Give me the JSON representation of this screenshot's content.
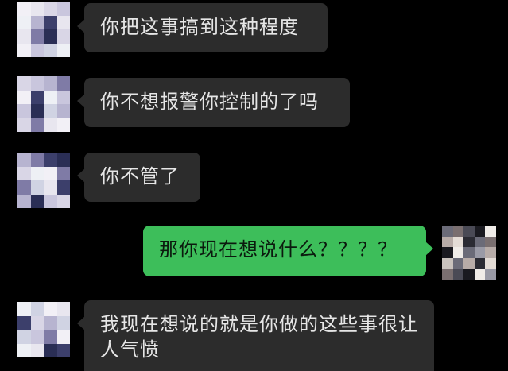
{
  "conversation": {
    "messages": [
      {
        "side": "in",
        "text": "你把这事搞到这种程度"
      },
      {
        "side": "in",
        "text": "你不想报警你控制的了吗"
      },
      {
        "side": "in",
        "text": "你不管了"
      },
      {
        "side": "out",
        "text": "那你现在想说什么？？？？"
      },
      {
        "side": "in",
        "text": "我现在想说的就是你做的这些事很让人气愤"
      }
    ]
  },
  "colors": {
    "background": "#000000",
    "incoming_bubble": "#2c2c2c",
    "outgoing_bubble": "#3dbe5a",
    "incoming_text": "#e6e6e6"
  }
}
